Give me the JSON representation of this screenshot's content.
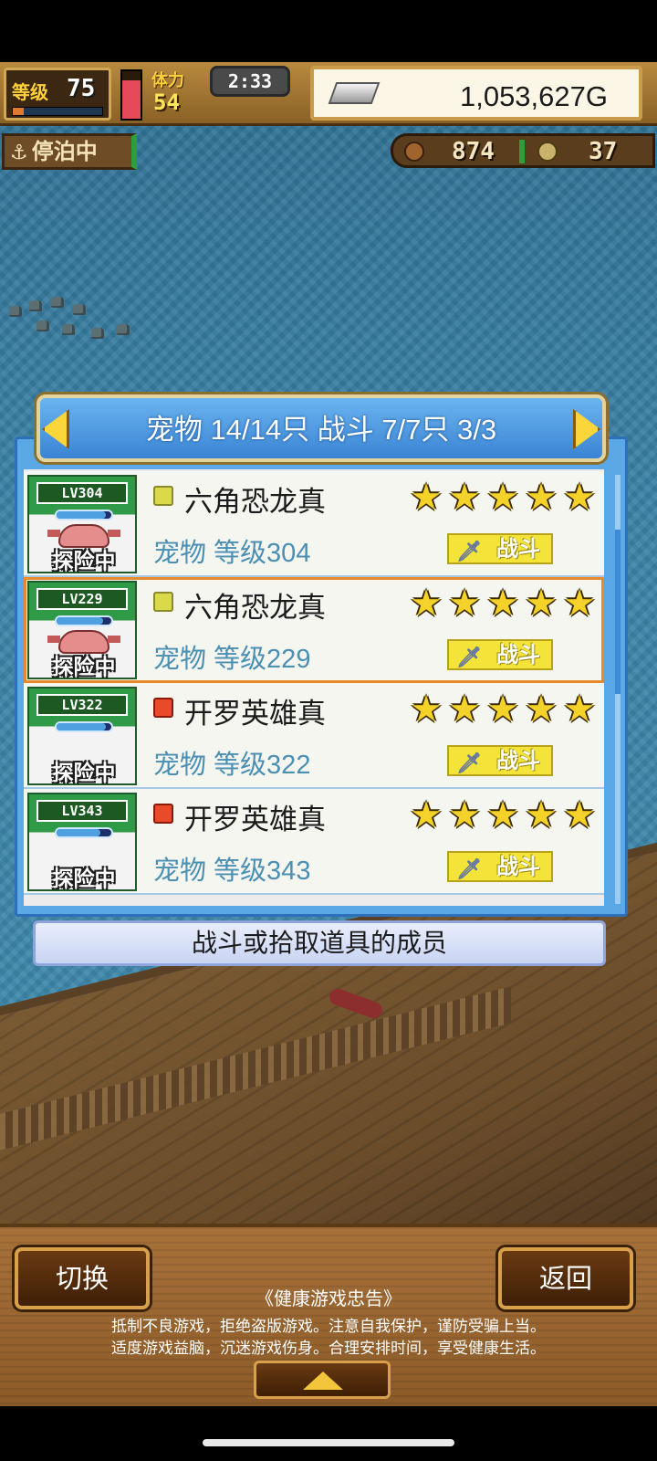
{
  "hud": {
    "level_label": "等级",
    "level_value": "75",
    "xp_fraction": 0.12,
    "hp_fraction": 0.8,
    "stamina_label": "体力",
    "stamina_value": "54",
    "clock": "2:33",
    "gold": "1,053,627G"
  },
  "status": {
    "anchor_label": "停泊中",
    "food": "874",
    "medals": "37"
  },
  "panel": {
    "title": "宠物 14/14只 战斗 7/7只  3/3",
    "rows": [
      {
        "level_tag": "LV304",
        "exp_fraction": 0.9,
        "status": "探险中",
        "element": "leaf",
        "name": "六角恐龙真",
        "subtitle": "宠物 等级304",
        "stars": 5,
        "action": "战斗",
        "selected": false
      },
      {
        "level_tag": "LV229",
        "exp_fraction": 0.85,
        "status": "探险中",
        "element": "leaf",
        "name": "六角恐龙真",
        "subtitle": "宠物 等级229",
        "stars": 5,
        "action": "战斗",
        "selected": true
      },
      {
        "level_tag": "LV322",
        "exp_fraction": 0.9,
        "status": "探险中",
        "element": "fire",
        "name": "开罗英雄真",
        "subtitle": "宠物 等级322",
        "stars": 5,
        "action": "战斗",
        "selected": false
      },
      {
        "level_tag": "LV343",
        "exp_fraction": 0.8,
        "status": "探险中",
        "element": "fire",
        "name": "开罗英雄真",
        "subtitle": "宠物 等级343",
        "stars": 5,
        "action": "战斗",
        "selected": false
      }
    ],
    "hint": "战斗或拾取道具的成员"
  },
  "bottom": {
    "switch_label": "切换",
    "back_label": "返回",
    "notice_title": "《健康游戏忠告》",
    "notice_line_1": "抵制不良游戏，拒绝盗版游戏。注意自我保护，谨防受骗上当。",
    "notice_line_2": "适度游戏益脑，沉迷游戏伤身。合理安排时间，享受健康生活。"
  }
}
